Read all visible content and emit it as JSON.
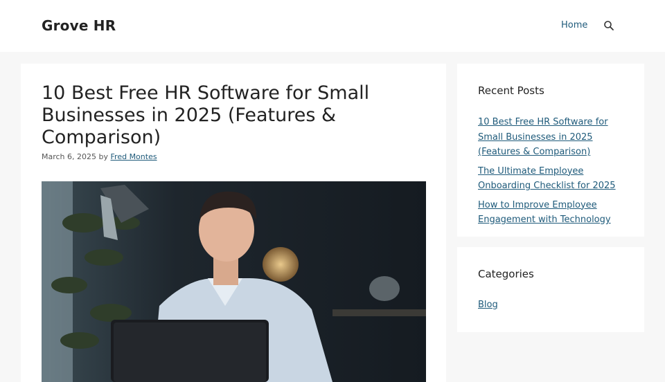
{
  "site": {
    "title": "Grove HR"
  },
  "nav": {
    "home_label": "Home"
  },
  "post": {
    "title": "10 Best Free HR Software for Small Businesses in 2025 (Features & Comparison)",
    "date": "March 6, 2025",
    "by": "by",
    "author": "Fred Montes"
  },
  "sidebar": {
    "recent_title": "Recent Posts",
    "recent_posts": [
      "10 Best Free HR Software for Small Businesses in 2025 (Features & Comparison)",
      "The Ultimate Employee Onboarding Checklist for 2025",
      "How to Improve Employee Engagement with Technology"
    ],
    "categories_title": "Categories",
    "categories": [
      "Blog"
    ]
  },
  "icons": {
    "search": "search-icon"
  },
  "colors": {
    "link": "#1e5a7a",
    "background": "#f7f7f7",
    "card": "#ffffff"
  }
}
